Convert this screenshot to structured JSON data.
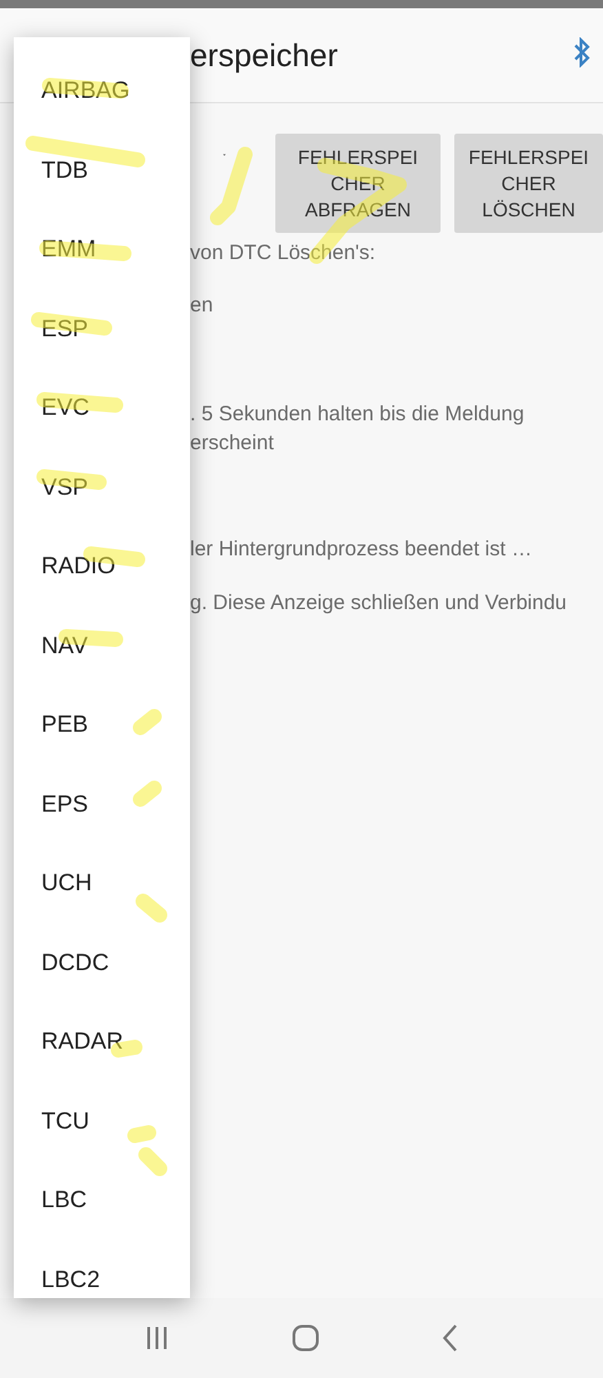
{
  "header": {
    "title": "erspeicher"
  },
  "buttons": [
    "FEHLERSPEI CHER ABFRAGEN",
    "FEHLERSPEI CHER LÖSCHEN"
  ],
  "lines": [
    "von DTC Löschen's:",
    "en",
    ". 5 Sekunden halten bis die Meldung erscheint",
    "ler Hintergrundprozess beendet ist …",
    "g. Diese Anzeige schließen und Verbindu"
  ],
  "dropdown": {
    "items": [
      "AIRBAG",
      "TDB",
      "EMM",
      "ESP",
      "EVC",
      "VSP",
      "RADIO",
      "NAV",
      "PEB",
      "EPS",
      "UCH",
      "DCDC",
      "RADAR",
      "TCU",
      "LBC",
      "LBC2"
    ]
  }
}
